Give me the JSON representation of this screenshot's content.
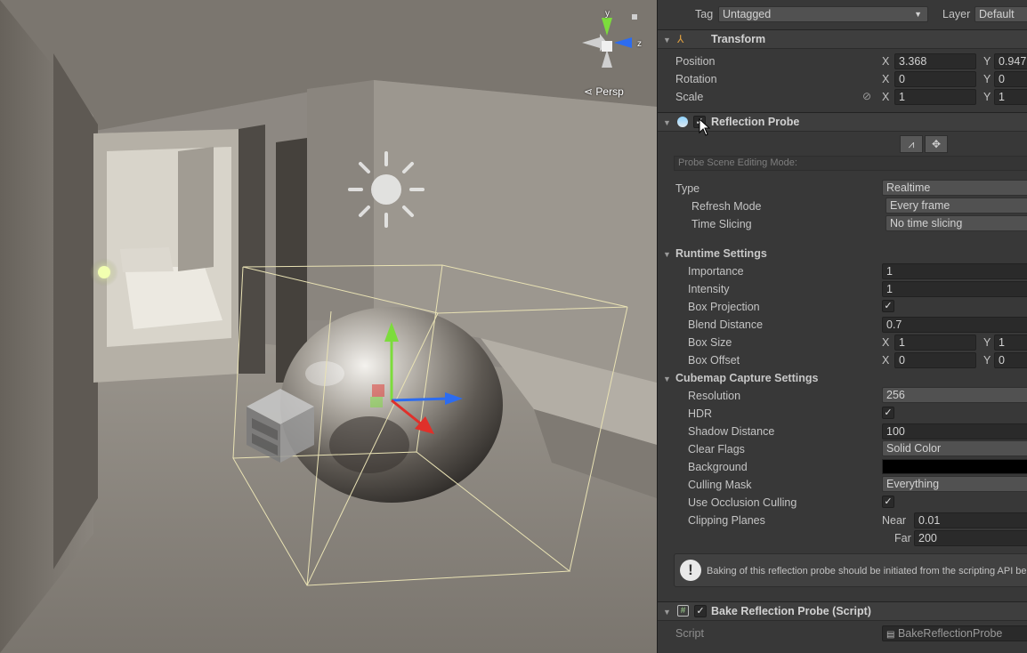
{
  "scene": {
    "view_mode_label": "Persp",
    "axis_labels": {
      "y": "y",
      "z": "z"
    }
  },
  "inspector": {
    "tag_label": "Tag",
    "tag_value": "Untagged",
    "layer_label": "Layer",
    "layer_value": "Default",
    "transform": {
      "title": "Transform",
      "position_label": "Position",
      "rotation_label": "Rotation",
      "scale_label": "Scale",
      "x_label": "X",
      "y_label": "Y",
      "position": {
        "x": "3.368",
        "y": "0.947"
      },
      "rotation": {
        "x": "0",
        "y": "0"
      },
      "scale": {
        "x": "1",
        "y": "1"
      }
    },
    "probe": {
      "title": "Reflection Probe",
      "enabled_mark": "✓",
      "edit_mode_placeholder": "Probe Scene Editing Mode:",
      "type_label": "Type",
      "type_value": "Realtime",
      "refresh_label": "Refresh Mode",
      "refresh_value": "Every frame",
      "slicing_label": "Time Slicing",
      "slicing_value": "No time slicing",
      "runtime_title": "Runtime Settings",
      "importance_label": "Importance",
      "importance_value": "1",
      "intensity_label": "Intensity",
      "intensity_value": "1",
      "box_projection_label": "Box Projection",
      "box_projection_mark": "✓",
      "blend_label": "Blend Distance",
      "blend_value": "0.7",
      "box_size_label": "Box Size",
      "box_size": {
        "x": "1",
        "y": "1"
      },
      "box_offset_label": "Box Offset",
      "box_offset": {
        "x": "0",
        "y": "0"
      },
      "cubemap_title": "Cubemap Capture Settings",
      "resolution_label": "Resolution",
      "resolution_value": "256",
      "hdr_label": "HDR",
      "hdr_mark": "✓",
      "shadow_label": "Shadow Distance",
      "shadow_value": "100",
      "clear_label": "Clear Flags",
      "clear_value": "Solid Color",
      "background_label": "Background",
      "background_color": "#000000",
      "culling_label": "Culling Mask",
      "culling_value": "Everything",
      "occlusion_label": "Use Occlusion Culling",
      "occlusion_mark": "✓",
      "clipping_label": "Clipping Planes",
      "near_label": "Near",
      "near_value": "0.01",
      "far_label": "Far",
      "far_value": "200",
      "help_text": "Baking of this reflection probe should be initiated from the scripting API bec",
      "help_icon": "!"
    },
    "bake_script": {
      "title": "Bake Reflection Probe (Script)",
      "enabled_mark": "✓",
      "script_label": "Script",
      "script_value": "BakeReflectionProbe"
    }
  },
  "colors": {
    "gizmo_x": "#e0302a",
    "gizmo_y": "#7cdc3c",
    "gizmo_z": "#2c6cf0",
    "bounds": "#e9e2b4"
  }
}
